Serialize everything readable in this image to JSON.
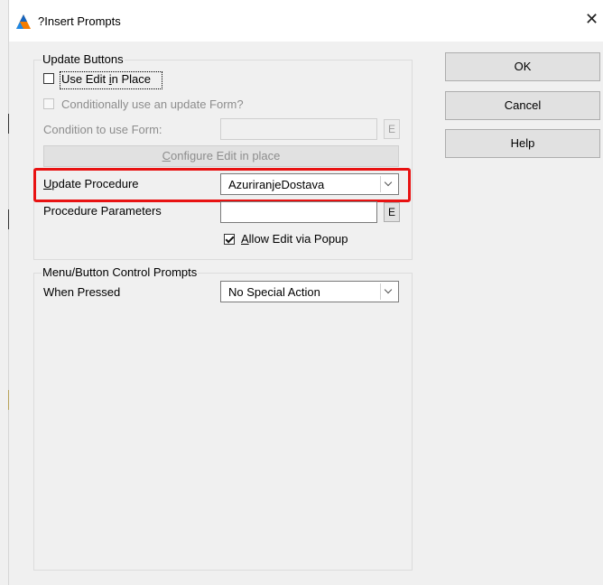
{
  "window": {
    "title": "?Insert Prompts",
    "close_glyph": "✕",
    "icon": "app-triangle-icon"
  },
  "update_buttons": {
    "group_label": "Update Buttons",
    "use_edit_in_place": {
      "label_pre": "Use Edit ",
      "label_u": "i",
      "label_post": "n Place",
      "checked": false
    },
    "conditionally_use_form": {
      "label": "Conditionally use an update Form?",
      "checked": false,
      "enabled": false
    },
    "condition_label": "Condition to use Form:",
    "condition_value": "",
    "condition_e_label": "E",
    "configure_btn": {
      "label_u": "C",
      "label_rest": "onfigure Edit in place"
    },
    "update_procedure": {
      "label_u": "U",
      "label_rest": "pdate Procedure",
      "value": "AzuriranjeDostava"
    },
    "procedure_parameters": {
      "label": "Procedure Parameters",
      "value": "",
      "e_label": "E"
    },
    "allow_edit_popup": {
      "label_u": "A",
      "label_rest": "llow Edit via Popup",
      "checked": true
    }
  },
  "menu_button_prompts": {
    "group_label": "Menu/Button Control Prompts",
    "when_pressed_label": "When Pressed",
    "when_pressed_value": "No Special Action"
  },
  "buttons": {
    "ok": "OK",
    "cancel": "Cancel",
    "help": "Help"
  },
  "colors": {
    "highlight": "#e81212",
    "dialog_bg": "#f0f0f0"
  }
}
